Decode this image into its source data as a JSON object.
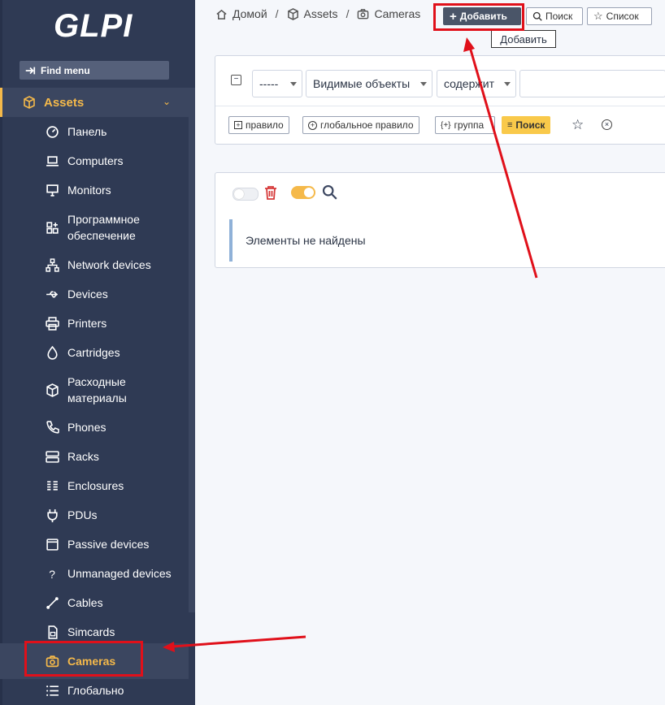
{
  "sidebar": {
    "logo": "GLPI",
    "find_menu": "Find menu",
    "section": "Assets",
    "items": [
      {
        "label": "Панель",
        "icon": "gauge-icon"
      },
      {
        "label": "Computers",
        "icon": "laptop-icon"
      },
      {
        "label": "Monitors",
        "icon": "monitor-icon"
      },
      {
        "label": "Программное обеспечение",
        "icon": "apps-icon"
      },
      {
        "label": "Network devices",
        "icon": "network-icon"
      },
      {
        "label": "Devices",
        "icon": "usb-icon"
      },
      {
        "label": "Printers",
        "icon": "printer-icon"
      },
      {
        "label": "Cartridges",
        "icon": "droplet-icon"
      },
      {
        "label": "Расходные материалы",
        "icon": "package-icon"
      },
      {
        "label": "Phones",
        "icon": "phone-icon"
      },
      {
        "label": "Racks",
        "icon": "server-icon"
      },
      {
        "label": "Enclosures",
        "icon": "columns-icon"
      },
      {
        "label": "PDUs",
        "icon": "plug-icon"
      },
      {
        "label": "Passive devices",
        "icon": "browser-icon"
      },
      {
        "label": "Unmanaged devices",
        "icon": "question-icon"
      },
      {
        "label": "Cables",
        "icon": "cable-icon"
      },
      {
        "label": "Simcards",
        "icon": "simcard-icon"
      },
      {
        "label": "Cameras",
        "icon": "camera-icon"
      },
      {
        "label": "Глобально",
        "icon": "list-icon"
      }
    ]
  },
  "breadcrumb": {
    "home": "Домой",
    "assets": "Assets",
    "current": "Cameras"
  },
  "toolbar": {
    "add": "Добавить",
    "search": "Поиск",
    "list": "Список",
    "tooltip": "Добавить"
  },
  "search": {
    "field1": "-----",
    "field2": "Видимые объекты",
    "field3": "содержит",
    "rule": "правило",
    "global_rule": "глобальное правило",
    "group": "группа",
    "search_button": "Поиск"
  },
  "results": {
    "empty": "Элементы не найдены"
  },
  "colors": {
    "accent": "#f5b94a",
    "sidebar": "#2f3a54",
    "annotation": "#e0101a"
  }
}
